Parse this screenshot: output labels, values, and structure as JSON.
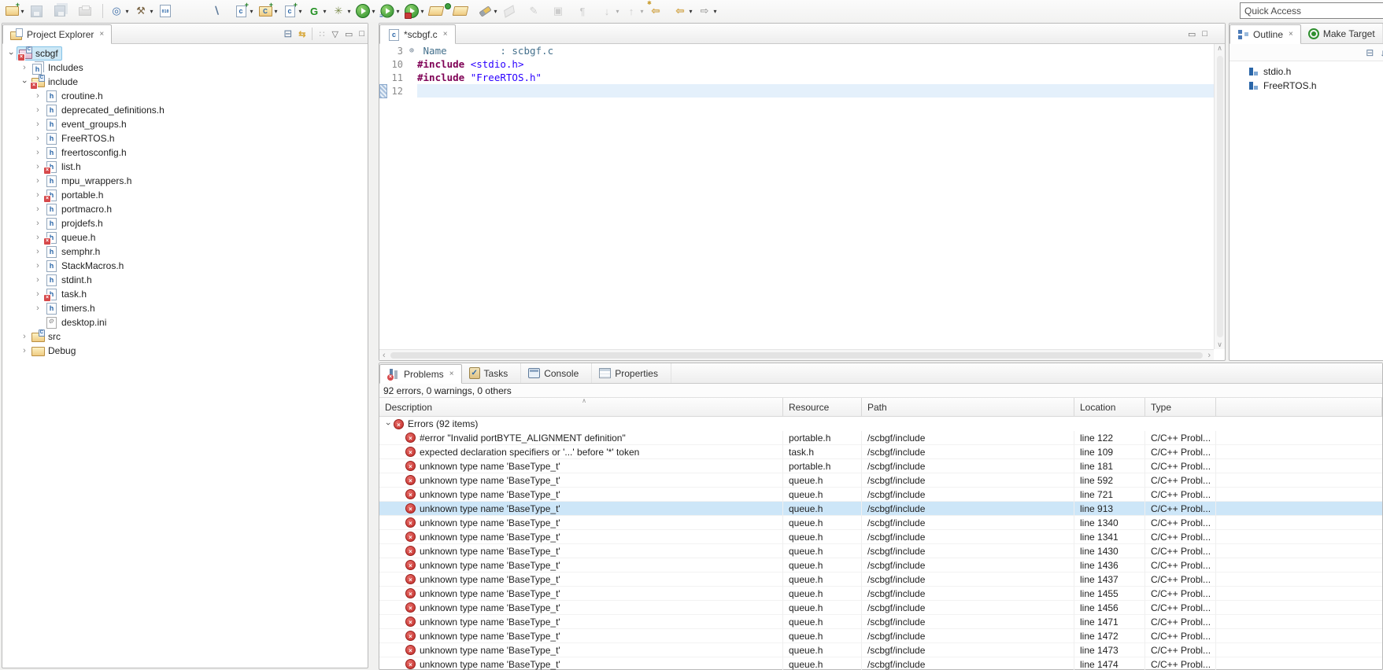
{
  "glyphs": {
    "dropdown": "▾",
    "chevron": "›",
    "close": "×",
    "scroll_up": "∧",
    "scroll_down": "∨",
    "scroll_left": "‹",
    "scroll_right": "›",
    "sort_asc": "∧",
    "fold_plus": "⊕",
    "collapse_all": "⊟",
    "link_editor": "⇆",
    "view_menu_dots": "∷",
    "view_menu": "▽",
    "minimize": "▭",
    "maximize": "□",
    "sort_az": "↓a"
  },
  "colors": {
    "selection_blue": "#CDE6F8",
    "current_line_blue": "#E4F0FB",
    "error_red": "#C22E2A",
    "directive_purple": "#7F0055",
    "string_blue": "#2A00FF",
    "comment_teal": "#44708C",
    "folder_yellow": "#EFCB82"
  },
  "window": {
    "quick_access_label": "Quick Access"
  },
  "toolbar": {
    "items": [
      {
        "name": "new-wizard-icon",
        "cls": "shape-folder",
        "glyph": "",
        "dd": "▾"
      },
      {
        "name": "save-icon",
        "cls": "ic-save dim",
        "glyph": ""
      },
      {
        "name": "save-all-icon",
        "cls": "ic-saveall dim",
        "glyph": ""
      },
      {
        "name": "print-icon",
        "cls": "ic-print dim",
        "glyph": ""
      },
      {
        "name": "toolbar-separator",
        "cls": "sep",
        "glyph": ""
      },
      {
        "name": "debug-target-icon",
        "cls": "",
        "glyph": "◎",
        "gcls": "glyph-c-blue",
        "dd": "▾"
      },
      {
        "name": "build-hammer-icon",
        "cls": "",
        "glyph": "⚒",
        "gcls": "glyph-c-brown",
        "dd": "▾"
      },
      {
        "name": "binary-file-icon",
        "cls": "ic-binary",
        "glyph": ""
      },
      {
        "name": "skip-breakpoints-icon",
        "cls": "gap",
        "glyph": "∖",
        "gcls": "glyph-c-steel"
      },
      {
        "name": "new-c-source-icon",
        "cls": "ic-cnew",
        "glyph": "",
        "dd": "▾"
      },
      {
        "name": "new-c-folder-icon",
        "cls": "ic-cfolder",
        "glyph": "",
        "dd": "▾"
      },
      {
        "name": "new-c-file-icon",
        "cls": "ic-cnew",
        "glyph": "",
        "dd": "▾"
      },
      {
        "name": "new-make-target-icon",
        "cls": "",
        "glyph": "G",
        "gcls": "glyph-c-green",
        "dd": "▾"
      },
      {
        "name": "external-tools-icon",
        "cls": "",
        "glyph": "✳",
        "gcls": "glyph-c-olive",
        "dd": "▾"
      },
      {
        "name": "run-icon",
        "cls": "shape-play",
        "glyph": "",
        "dd": "▾"
      },
      {
        "name": "run-configurations-icon",
        "cls": "shape-play ic-runlist",
        "glyph": "",
        "dd": "▾"
      },
      {
        "name": "run-external-icon",
        "cls": "shape-play ic-runext",
        "glyph": "",
        "dd": "▾"
      },
      {
        "name": "open-resource-icon",
        "cls": "ic-ofolder badge-green",
        "glyph": ""
      },
      {
        "name": "open-folder-icon",
        "cls": "ic-ofolder",
        "glyph": ""
      },
      {
        "name": "open-element-icon",
        "cls": "ic-flash",
        "glyph": "",
        "dd": "▾"
      },
      {
        "name": "eraser-icon",
        "cls": "ic-eraser dim",
        "glyph": ""
      },
      {
        "name": "mark-occurrences-icon",
        "cls": "dim",
        "glyph": "✎",
        "gcls": "glyph-c-gray"
      },
      {
        "name": "format-block-icon",
        "cls": "dim",
        "glyph": "▣",
        "gcls": "glyph-c-gray"
      },
      {
        "name": "show-whitespace-icon",
        "cls": "dim",
        "glyph": "¶",
        "gcls": "glyph-c-gray"
      },
      {
        "name": "next-annotation-icon",
        "cls": "dim",
        "glyph": "↓",
        "gcls": "glyph-c-gray",
        "dd": "▾"
      },
      {
        "name": "previous-annotation-icon",
        "cls": "dim",
        "glyph": "↑",
        "gcls": "glyph-c-gray",
        "dd": "▾"
      },
      {
        "name": "last-edit-location-icon",
        "cls": "ic-lastedit",
        "glyph": "⇦",
        "gcls": "glyph-c-yellow"
      },
      {
        "name": "back-icon",
        "cls": "",
        "glyph": "⇦",
        "gcls": "glyph-c-yellow",
        "dd": "▾"
      },
      {
        "name": "forward-icon",
        "cls": "",
        "glyph": "⇨",
        "gcls": "glyph-c-gray",
        "dd": "▾"
      }
    ]
  },
  "explorer": {
    "title": "Project Explorer",
    "tree": [
      {
        "label": "scbgf",
        "level": 0,
        "exp": "›",
        "expcls": "rot",
        "icon": "ic-proj err",
        "cls": "sel"
      },
      {
        "label": "Includes",
        "level": 1,
        "exp": "›",
        "expcls": "",
        "icon": "ic-includes",
        "cls": ""
      },
      {
        "label": "include",
        "level": 1,
        "exp": "›",
        "expcls": "rot",
        "icon": "ic-folderc err",
        "cls": ""
      },
      {
        "label": "croutine.h",
        "level": 2,
        "exp": "›",
        "expcls": "",
        "icon": "ic-h",
        "cls": ""
      },
      {
        "label": "deprecated_definitions.h",
        "level": 2,
        "exp": "›",
        "expcls": "",
        "icon": "ic-h",
        "cls": ""
      },
      {
        "label": "event_groups.h",
        "level": 2,
        "exp": "›",
        "expcls": "",
        "icon": "ic-h",
        "cls": ""
      },
      {
        "label": "FreeRTOS.h",
        "level": 2,
        "exp": "›",
        "expcls": "",
        "icon": "ic-h",
        "cls": ""
      },
      {
        "label": "freertosconfig.h",
        "level": 2,
        "exp": "›",
        "expcls": "",
        "icon": "ic-h",
        "cls": ""
      },
      {
        "label": "list.h",
        "level": 2,
        "exp": "›",
        "expcls": "",
        "icon": "ic-h err",
        "cls": ""
      },
      {
        "label": "mpu_wrappers.h",
        "level": 2,
        "exp": "›",
        "expcls": "",
        "icon": "ic-h",
        "cls": ""
      },
      {
        "label": "portable.h",
        "level": 2,
        "exp": "›",
        "expcls": "",
        "icon": "ic-h err",
        "cls": ""
      },
      {
        "label": "portmacro.h",
        "level": 2,
        "exp": "›",
        "expcls": "",
        "icon": "ic-h",
        "cls": ""
      },
      {
        "label": "projdefs.h",
        "level": 2,
        "exp": "›",
        "expcls": "",
        "icon": "ic-h",
        "cls": ""
      },
      {
        "label": "queue.h",
        "level": 2,
        "exp": "›",
        "expcls": "",
        "icon": "ic-h err",
        "cls": ""
      },
      {
        "label": "semphr.h",
        "level": 2,
        "exp": "›",
        "expcls": "",
        "icon": "ic-h",
        "cls": ""
      },
      {
        "label": "StackMacros.h",
        "level": 2,
        "exp": "›",
        "expcls": "",
        "icon": "ic-h",
        "cls": ""
      },
      {
        "label": "stdint.h",
        "level": 2,
        "exp": "›",
        "expcls": "",
        "icon": "ic-h",
        "cls": ""
      },
      {
        "label": "task.h",
        "level": 2,
        "exp": "›",
        "expcls": "",
        "icon": "ic-h err",
        "cls": ""
      },
      {
        "label": "timers.h",
        "level": 2,
        "exp": "›",
        "expcls": "",
        "icon": "ic-h",
        "cls": ""
      },
      {
        "label": "desktop.ini",
        "level": 2,
        "exp": "",
        "expcls": "",
        "icon": "ic-ini",
        "cls": ""
      },
      {
        "label": "src",
        "level": 1,
        "exp": "›",
        "expcls": "",
        "icon": "ic-src",
        "cls": ""
      },
      {
        "label": "Debug",
        "level": 1,
        "exp": "›",
        "expcls": "",
        "icon": "ic-folder",
        "cls": ""
      }
    ]
  },
  "editor": {
    "tab_label": "*scbgf.c",
    "lines": [
      {
        "n": "3",
        "f": "⊕",
        "t1": " Name         : scbgf.c",
        "c1": "tok-comment",
        "t2": "",
        "c2": "",
        "cls": ""
      },
      {
        "n": "10",
        "f": "",
        "t1": "#include ",
        "c1": "tok-dir",
        "t2": "<stdio.h>",
        "c2": "tok-str",
        "cls": ""
      },
      {
        "n": "11",
        "f": "",
        "t1": "#include ",
        "c1": "tok-dir",
        "t2": "\"FreeRTOS.h\"",
        "c2": "tok-str",
        "cls": ""
      },
      {
        "n": "12",
        "f": "",
        "t1": "",
        "c1": "",
        "t2": "",
        "c2": "",
        "cls": "cur"
      }
    ]
  },
  "outline": {
    "tab_label": "Outline",
    "tab2_label": "Make Target",
    "items": [
      {
        "label": "stdio.h"
      },
      {
        "label": "FreeRTOS.h"
      }
    ]
  },
  "problems": {
    "tabs": [
      {
        "label": "Problems",
        "icon": "ic-problems",
        "cls": "active",
        "close": "×",
        "name": "tab-problems"
      },
      {
        "label": "Tasks",
        "icon": "ic-tasks",
        "cls": "",
        "close": "",
        "name": "tab-tasks"
      },
      {
        "label": "Console",
        "icon": "ic-console",
        "cls": "",
        "close": "",
        "name": "tab-console"
      },
      {
        "label": "Properties",
        "icon": "ic-props",
        "cls": "",
        "close": "",
        "name": "tab-properties"
      }
    ],
    "summary": "92 errors, 0 warnings, 0 others",
    "group_label": "Errors (92 items)",
    "headers": {
      "description": "Description",
      "resource": "Resource",
      "path": "Path",
      "location": "Location",
      "type": "Type"
    },
    "rows": [
      {
        "desc": "#error \"Invalid portBYTE_ALIGNMENT definition\"",
        "res": "portable.h",
        "path": "/scbgf/include",
        "loc": "line 122",
        "type": "C/C++ Probl...",
        "cls": ""
      },
      {
        "desc": "expected declaration specifiers or '...' before '*' token",
        "res": "task.h",
        "path": "/scbgf/include",
        "loc": "line 109",
        "type": "C/C++ Probl...",
        "cls": ""
      },
      {
        "desc": "unknown type name 'BaseType_t'",
        "res": "portable.h",
        "path": "/scbgf/include",
        "loc": "line 181",
        "type": "C/C++ Probl...",
        "cls": ""
      },
      {
        "desc": "unknown type name 'BaseType_t'",
        "res": "queue.h",
        "path": "/scbgf/include",
        "loc": "line 592",
        "type": "C/C++ Probl...",
        "cls": ""
      },
      {
        "desc": "unknown type name 'BaseType_t'",
        "res": "queue.h",
        "path": "/scbgf/include",
        "loc": "line 721",
        "type": "C/C++ Probl...",
        "cls": ""
      },
      {
        "desc": "unknown type name 'BaseType_t'",
        "res": "queue.h",
        "path": "/scbgf/include",
        "loc": "line 913",
        "type": "C/C++ Probl...",
        "cls": "sel"
      },
      {
        "desc": "unknown type name 'BaseType_t'",
        "res": "queue.h",
        "path": "/scbgf/include",
        "loc": "line 1340",
        "type": "C/C++ Probl...",
        "cls": ""
      },
      {
        "desc": "unknown type name 'BaseType_t'",
        "res": "queue.h",
        "path": "/scbgf/include",
        "loc": "line 1341",
        "type": "C/C++ Probl...",
        "cls": ""
      },
      {
        "desc": "unknown type name 'BaseType_t'",
        "res": "queue.h",
        "path": "/scbgf/include",
        "loc": "line 1430",
        "type": "C/C++ Probl...",
        "cls": ""
      },
      {
        "desc": "unknown type name 'BaseType_t'",
        "res": "queue.h",
        "path": "/scbgf/include",
        "loc": "line 1436",
        "type": "C/C++ Probl...",
        "cls": ""
      },
      {
        "desc": "unknown type name 'BaseType_t'",
        "res": "queue.h",
        "path": "/scbgf/include",
        "loc": "line 1437",
        "type": "C/C++ Probl...",
        "cls": ""
      },
      {
        "desc": "unknown type name 'BaseType_t'",
        "res": "queue.h",
        "path": "/scbgf/include",
        "loc": "line 1455",
        "type": "C/C++ Probl...",
        "cls": ""
      },
      {
        "desc": "unknown type name 'BaseType_t'",
        "res": "queue.h",
        "path": "/scbgf/include",
        "loc": "line 1456",
        "type": "C/C++ Probl...",
        "cls": ""
      },
      {
        "desc": "unknown type name 'BaseType_t'",
        "res": "queue.h",
        "path": "/scbgf/include",
        "loc": "line 1471",
        "type": "C/C++ Probl...",
        "cls": ""
      },
      {
        "desc": "unknown type name 'BaseType_t'",
        "res": "queue.h",
        "path": "/scbgf/include",
        "loc": "line 1472",
        "type": "C/C++ Probl...",
        "cls": ""
      },
      {
        "desc": "unknown type name 'BaseType_t'",
        "res": "queue.h",
        "path": "/scbgf/include",
        "loc": "line 1473",
        "type": "C/C++ Probl...",
        "cls": ""
      },
      {
        "desc": "unknown type name 'BaseType_t'",
        "res": "queue.h",
        "path": "/scbgf/include",
        "loc": "line 1474",
        "type": "C/C++ Probl...",
        "cls": ""
      }
    ]
  }
}
